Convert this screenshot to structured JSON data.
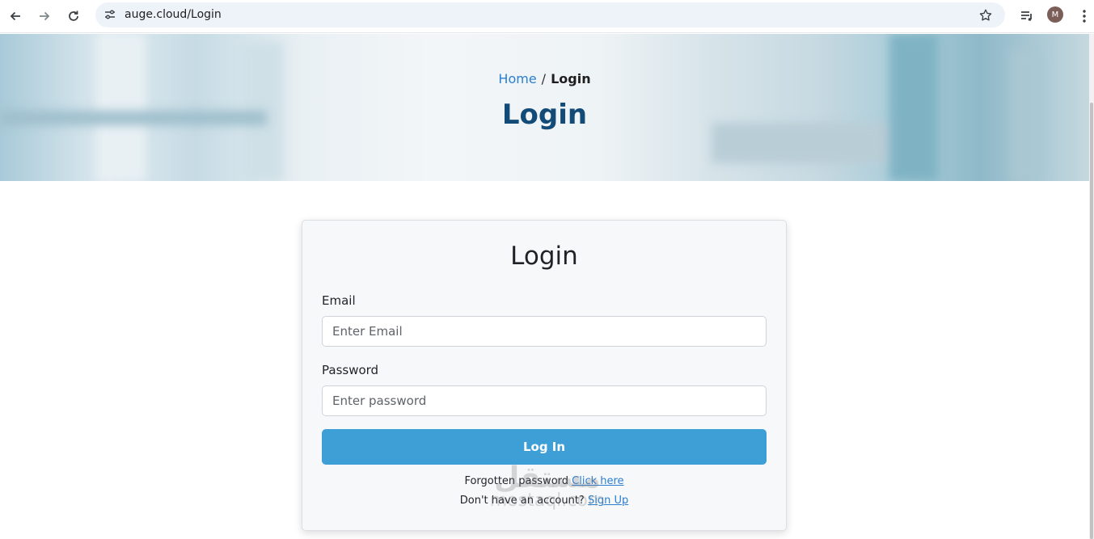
{
  "browser": {
    "url": "auge.cloud/Login",
    "profile_initial": "M",
    "icons": [
      "back-icon",
      "forward-icon",
      "reload-icon",
      "site-info-icon",
      "bookmark-star-icon",
      "media-control-icon",
      "menu-icon"
    ]
  },
  "hero": {
    "breadcrumb_home": "Home",
    "breadcrumb_separator": "/",
    "breadcrumb_current": "Login",
    "title": "Login"
  },
  "login_form": {
    "title": "Login",
    "email_label": "Email",
    "email_placeholder": "Enter Email",
    "email_value": "",
    "password_label": "Password",
    "password_placeholder": "Enter password",
    "password_value": "",
    "submit_label": "Log In",
    "forgot_text": "Forgotten password",
    "forgot_link": "Click here",
    "signup_text": "Don't have an account?",
    "signup_link": "Sign Up"
  },
  "watermark": {
    "arabic": "مستقل",
    "latin": "mostaql.com"
  },
  "colors": {
    "accent_button": "#3d9fd6",
    "hero_title": "#124a78",
    "link": "#2a7fd0"
  }
}
